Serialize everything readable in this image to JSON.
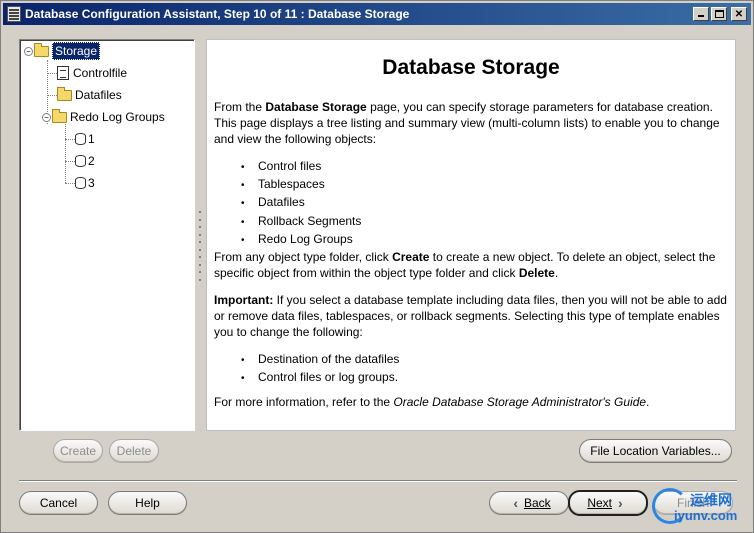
{
  "window": {
    "title": "Database Configuration Assistant, Step 10 of 11 : Database Storage"
  },
  "tree": {
    "root": "Storage",
    "controlfile": "Controlfile",
    "datafiles": "Datafiles",
    "redo_log_groups": "Redo Log Groups",
    "redo_items": [
      "1",
      "2",
      "3"
    ]
  },
  "content": {
    "title": "Database Storage",
    "intro_pre": "From the ",
    "intro_bold": "Database Storage",
    "intro_post": " page, you can specify storage parameters for database creation. This page displays a tree listing and summary view (multi-column lists) to enable you to change and view the following objects:",
    "objects": [
      "Control files",
      "Tablespaces",
      "Datafiles",
      "Rollback Segments",
      "Redo Log Groups"
    ],
    "create_pre": "From any object type folder, click ",
    "create_bold": "Create",
    "create_mid": " to create a new object. To delete an object, select the specific object from within the object type folder and click ",
    "delete_bold": "Delete",
    "create_post": ".",
    "important_label": "Important:",
    "important_text": " If you select a database template including data files, then you will not be able to add or remove data files, tablespaces, or rollback segments. Selecting this type of template enables you to change the following:",
    "changes": [
      "Destination of the datafiles",
      "Control files or log groups."
    ],
    "more_pre": "For more information, refer to the ",
    "more_italic": "Oracle Database Storage Administrator's Guide",
    "more_post": "."
  },
  "buttons": {
    "create": "Create",
    "delete": "Delete",
    "file_location_variables": "File Location Variables...",
    "cancel": "Cancel",
    "help": "Help",
    "back": "Back",
    "next": "Next",
    "finish": "Finish"
  },
  "watermark": {
    "top": "运维网",
    "bottom": "iyunv.com"
  },
  "colors": {
    "titlebar_start": "#0a246a",
    "titlebar_end": "#3a6ea5",
    "selection": "#0a246a"
  }
}
